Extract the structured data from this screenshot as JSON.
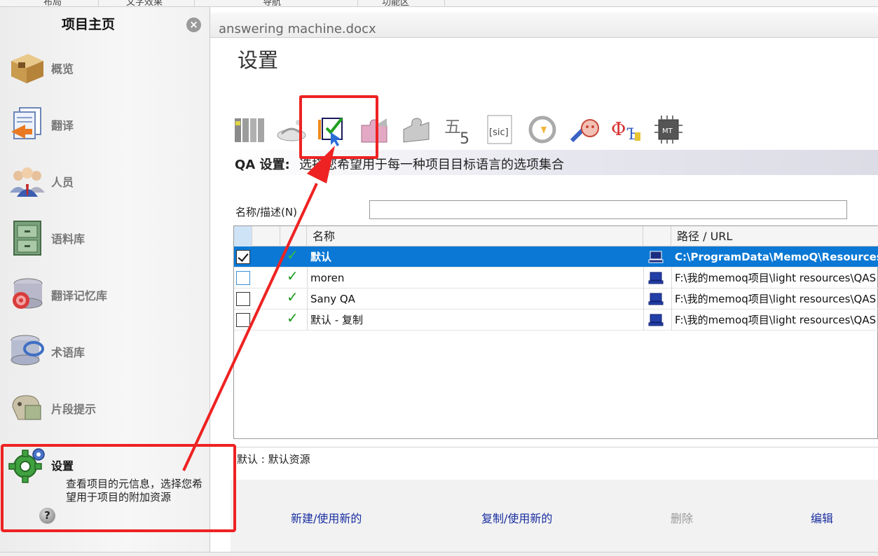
{
  "top_tabs": [
    "布局",
    "文字效果",
    "导航",
    "功能区"
  ],
  "sidebar": {
    "title": "项目主页",
    "items": [
      {
        "label": "概览",
        "icon": "box-icon"
      },
      {
        "label": "翻译",
        "icon": "documents-icon"
      },
      {
        "label": "人员",
        "icon": "people-icon"
      },
      {
        "label": "语料库",
        "icon": "cabinet-icon"
      },
      {
        "label": "翻译记忆库",
        "icon": "database-icon"
      },
      {
        "label": "术语库",
        "icon": "termbase-icon"
      },
      {
        "label": "片段提示",
        "icon": "muse-icon"
      },
      {
        "label": "设置",
        "icon": "gear-icon"
      }
    ],
    "active_description": "查看项目的元信息，选择您希望用于项目的附加资源"
  },
  "document_tab": "answering machine.docx",
  "main": {
    "title": "设置",
    "banner_bold": "QA 设置:",
    "banner_text": "选择您希望用于每一种项目目标语言的选项集合",
    "filter_label": "名称/描述(N)",
    "filter_value": "",
    "columns": {
      "name": "名称",
      "path": "路径 / URL"
    },
    "rows": [
      {
        "checked": true,
        "name": "默认",
        "path": "C:\\ProgramData\\MemoQ\\Resources"
      },
      {
        "checked": false,
        "name": "moren",
        "path": "F:\\我的memoq项目\\light resources\\QAS"
      },
      {
        "checked": false,
        "name": "Sany QA",
        "path": "F:\\我的memoq项目\\light resources\\QAS"
      },
      {
        "checked": false,
        "name": "默认 - 复制",
        "path": "F:\\我的memoq项目\\light resources\\QAS"
      }
    ],
    "status": "默认 : 默认资源",
    "actions": {
      "new": "新建/使用新的",
      "clone": "复制/使用新的",
      "delete": "删除",
      "edit": "编辑"
    }
  },
  "colors": {
    "selection": "#0a78d4",
    "annotation": "#ee2222",
    "link": "#1a2fa0"
  }
}
